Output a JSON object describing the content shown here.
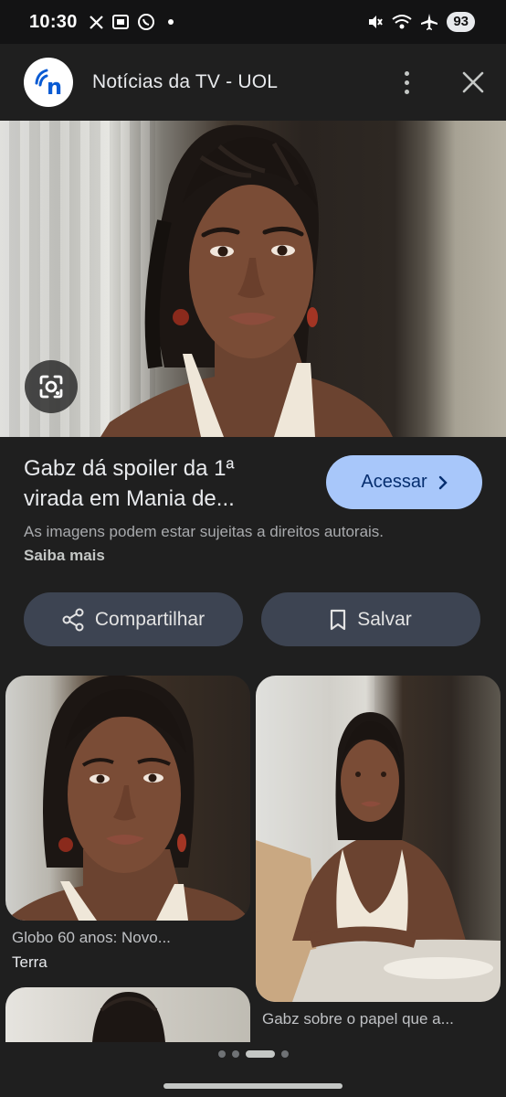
{
  "status_bar": {
    "time": "10:30",
    "battery": "93",
    "icons": [
      "x-icon",
      "screenshot-icon",
      "whatsapp-icon",
      "dot-icon",
      "mute-icon",
      "wifi-icon",
      "airplane-icon"
    ]
  },
  "header": {
    "site_logo_letter": "n",
    "title": "Notícias da TV - UOL",
    "menu_icon": "more-vert-icon",
    "close_icon": "close-icon"
  },
  "article": {
    "title": "Gabz dá spoiler da 1ª virada em Mania de...",
    "access_label": "Acessar",
    "copyright_text": "As imagens podem estar sujeitas a direitos autorais.",
    "learn_more": "Saiba mais"
  },
  "actions": {
    "share_label": "Compartilhar",
    "save_label": "Salvar"
  },
  "related": [
    {
      "caption": "Globo 60 anos: Novo...",
      "source": "Terra"
    },
    {
      "caption": "Gabz sobre o papel que a..."
    }
  ],
  "colors": {
    "background": "#1f1f1f",
    "accent": "#a8c7fa",
    "pill": "#3d4452"
  }
}
